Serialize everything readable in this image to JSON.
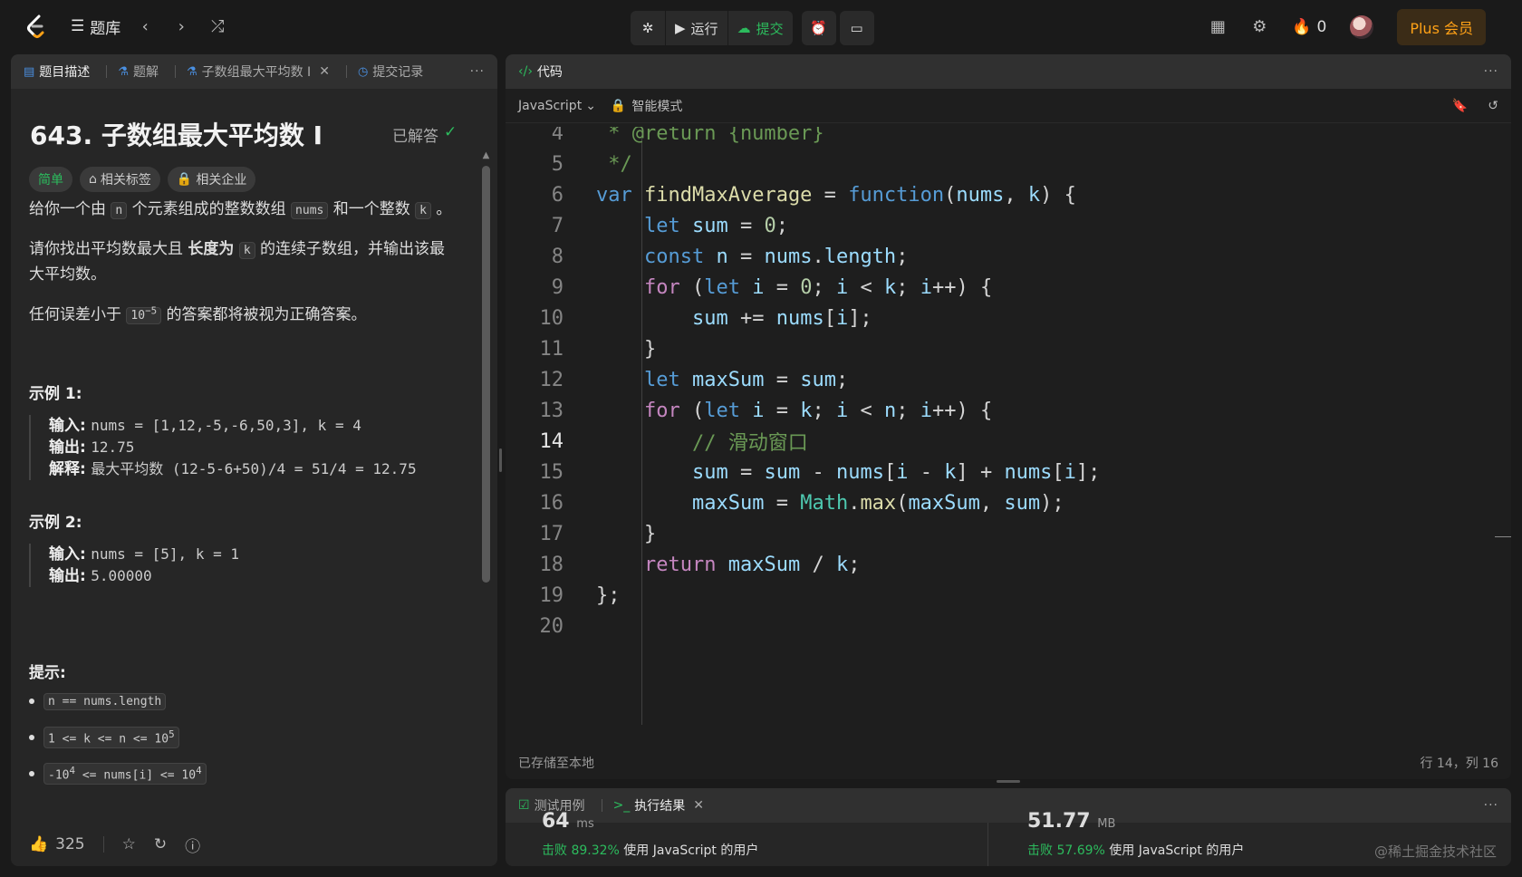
{
  "topbar": {
    "problem_list": "题库",
    "run": "运行",
    "submit": "提交",
    "streak": "0",
    "plus": "Plus 会员"
  },
  "left": {
    "tabs": [
      "题目描述",
      "题解",
      "子数组最大平均数 I",
      "提交记录"
    ],
    "title": "643. 子数组最大平均数 I",
    "solved": "已解答",
    "tags": [
      "简单",
      "相关标签",
      "相关企业"
    ],
    "desc": {
      "p1_a": "给你一个由",
      "p1_code1": "n",
      "p1_b": "个元素组成的整数数组",
      "p1_code2": "nums",
      "p1_c": "和一个整数",
      "p1_code3": "k",
      "p1_d": "。",
      "p2_a": "请你找出平均数最大且",
      "p2_bold": "长度为",
      "p2_code": "k",
      "p2_b": "的连续子数组，并输出该最大平均数。",
      "p3_a": "任何误差小于",
      "p3_code_base": "10",
      "p3_code_exp": "−5",
      "p3_b": "的答案都将被视为正确答案。"
    },
    "example1": {
      "heading": "示例 1:",
      "in_label": "输入:",
      "in_value": "nums = [1,12,-5,-6,50,3], k = 4",
      "out_label": "输出:",
      "out_value": "12.75",
      "exp_label": "解释:",
      "exp_value": "最大平均数 (12-5-6+50)/4 = 51/4 = 12.75"
    },
    "example2": {
      "heading": "示例 2:",
      "in_label": "输入:",
      "in_value": "nums = [5], k = 1",
      "out_label": "输出:",
      "out_value": "5.00000"
    },
    "hints_heading": "提示:",
    "constraints": [
      {
        "base": "n == nums.length",
        "exp": ""
      },
      {
        "base": "1 <= k <= n <= 10",
        "exp": "5"
      },
      {
        "pre": "-10",
        "pre_exp": "4",
        "base": " <= nums[i] <= 10",
        "exp": "4"
      }
    ],
    "likes": "325"
  },
  "code": {
    "tab": "代码",
    "language": "JavaScript",
    "mode": "智能模式",
    "saved": "已存储至本地",
    "cursor": "行 14，列 16",
    "current_line": 14
  },
  "result": {
    "tabs": [
      "测试用例",
      "执行结果"
    ],
    "runtime_value": "64",
    "runtime_unit": "ms",
    "runtime_beat_label": "击败 89.32%",
    "runtime_beat_suffix": "使用 JavaScript 的用户",
    "memory_value": "51.77",
    "memory_unit": "MB",
    "memory_beat_label": "击败 57.69%",
    "memory_beat_suffix": "使用 JavaScript 的用户"
  },
  "watermark": "@稀土掘金技术社区"
}
